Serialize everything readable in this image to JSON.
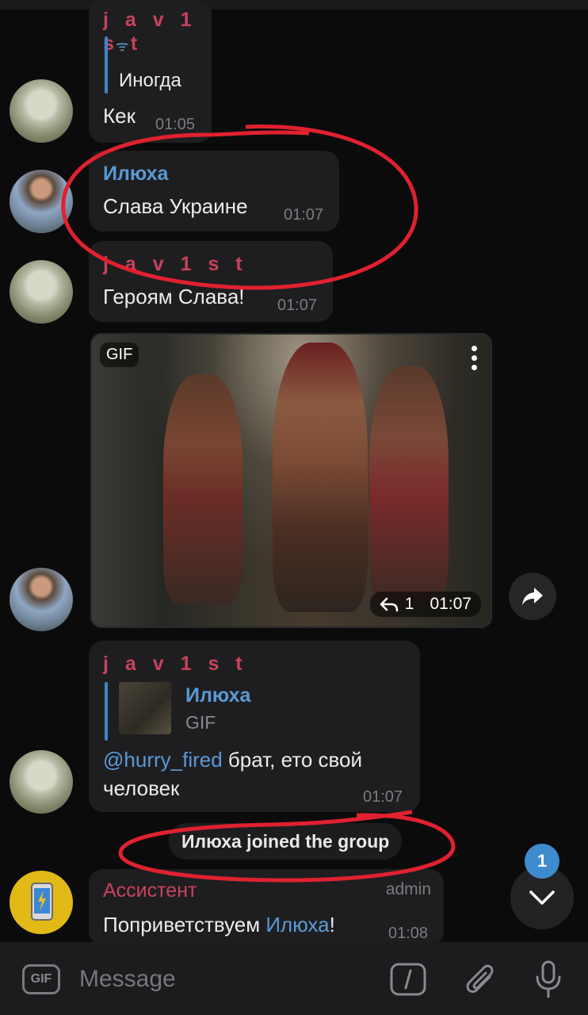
{
  "messages": {
    "m1": {
      "sender": "j a v 1 s t",
      "quote_icon": "ᯤ",
      "quote_text": "Иногда",
      "text": "Кек",
      "time": "01:05"
    },
    "m2": {
      "sender": "Илюха",
      "text": "Слава Украине",
      "time": "01:07"
    },
    "m3": {
      "sender": "j a v 1 s t",
      "text": "Героям Слава!",
      "time": "01:07"
    },
    "gif": {
      "label": "GIF",
      "replies": "1",
      "time": "01:07"
    },
    "m5": {
      "sender": "j a v 1 s t",
      "reply_name": "Илюха",
      "reply_type": "GIF",
      "mention": "@hurry_fired",
      "text_after_mention": " брат, ето свой",
      "text_line2": "человек",
      "time": "01:07"
    },
    "m7": {
      "sender": "Ассистент",
      "role": "admin",
      "text_before": "Поприветствуем ",
      "mention": "Илюха",
      "text_after": "!",
      "time": "01:08"
    }
  },
  "service": {
    "text": "Илюха joined the group"
  },
  "unread_badge": "1",
  "composer": {
    "gif_label": "GIF",
    "placeholder": "Message"
  },
  "colors": {
    "accent_blue": "#5a9ad6",
    "sender_red": "#c8425c",
    "annotation_red": "#e0212f",
    "badge_blue": "#3f8bd0"
  },
  "icons": [
    "forward-icon",
    "reply-icon",
    "more-vert-icon",
    "chevron-down-icon",
    "command-slash-icon",
    "attach-icon",
    "mic-icon"
  ]
}
